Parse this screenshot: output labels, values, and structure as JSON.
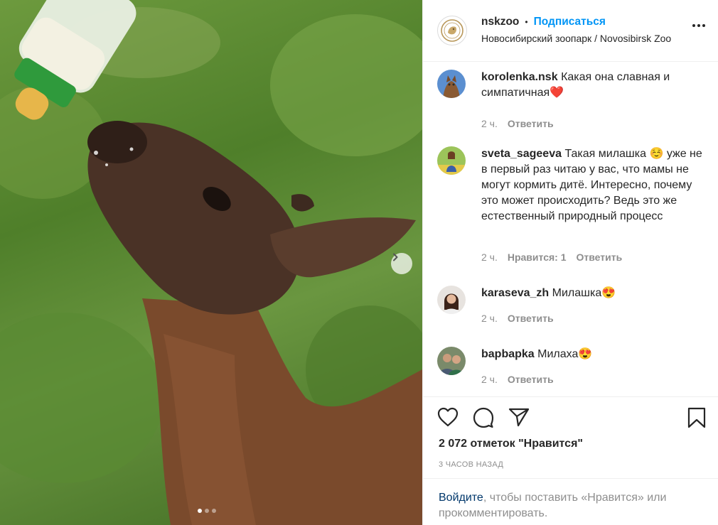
{
  "post": {
    "username": "nskzoo",
    "separator": "•",
    "follow_label": "Подписаться",
    "location": "Новосибирский зоопарк / Novosibirsk Zoo"
  },
  "comments": [
    {
      "user": "korolenka.nsk",
      "text": "Какая она славная и симпатичная❤️",
      "time": "2 ч.",
      "likes": "",
      "reply": "Ответить"
    },
    {
      "user": "sveta_sageeva",
      "text": "Такая милашка ☺️ уже не в первый раз читаю у вас, что мамы не могут кормить дитё. Интересно, почему это может происходить? Ведь это же естественный природный процесс",
      "time": "2 ч.",
      "likes": "Нравится: 1",
      "reply": "Ответить"
    },
    {
      "user": "karaseva_zh",
      "text": "Милашка😍",
      "time": "2 ч.",
      "likes": "",
      "reply": "Ответить"
    },
    {
      "user": "bapbapka",
      "text": "Милаха😍",
      "time": "2 ч.",
      "likes": "",
      "reply": "Ответить"
    }
  ],
  "likes_count": "2 072 отметок \"Нравится\"",
  "time_ago": "3 ЧАСОВ НАЗАД",
  "login_prompt": {
    "link": "Войдите",
    "text": ", чтобы поставить «Нравится» или прокомментировать."
  },
  "carousel": {
    "current": 1,
    "total": 3
  },
  "icons": [
    "heart-icon",
    "comment-icon",
    "share-icon",
    "bookmark-icon",
    "chevron-right-icon",
    "more-icon"
  ],
  "colors": {
    "accent": "#0095f6",
    "link_dark": "#00376b",
    "muted": "#8e8e8e",
    "text": "#262626",
    "divider": "#efefef"
  }
}
